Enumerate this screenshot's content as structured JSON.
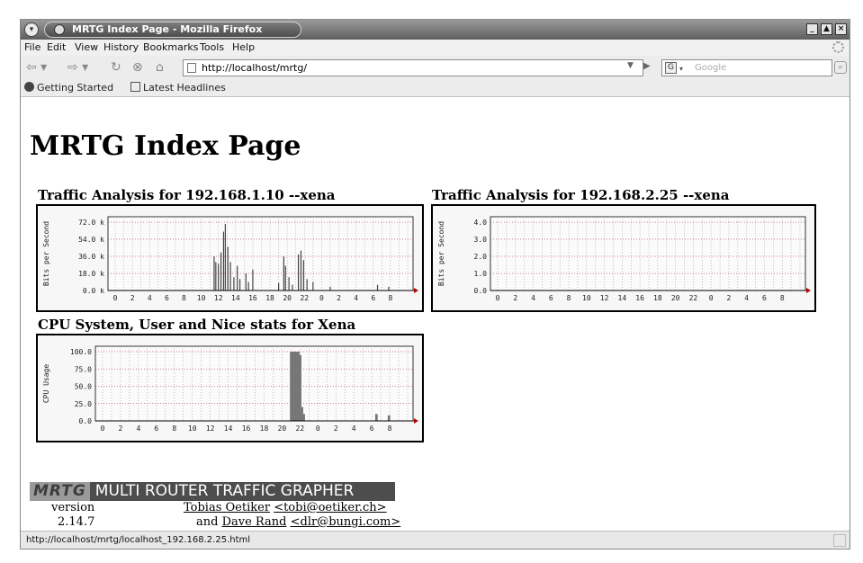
{
  "window": {
    "title": "MRTG Index Page - Mozilla Firefox",
    "controls": [
      "minimize-icon",
      "maximize-icon",
      "close-icon"
    ]
  },
  "menubar": {
    "items": [
      {
        "label": "File"
      },
      {
        "label": "Edit"
      },
      {
        "label": "View"
      },
      {
        "label": "History"
      },
      {
        "label": "Bookmarks"
      },
      {
        "label": "Tools"
      },
      {
        "label": "Help"
      }
    ]
  },
  "navbar": {
    "url": "http://localhost/mrtg/",
    "search_placeholder": "Google",
    "icons": [
      "back-icon",
      "forward-icon",
      "reload-icon",
      "stop-icon",
      "home-icon"
    ]
  },
  "bookmarks": {
    "items": [
      {
        "label": "Getting Started"
      },
      {
        "label": "Latest Headlines"
      }
    ]
  },
  "page": {
    "title": "MRTG Index Page",
    "graphs": [
      {
        "title": "Traffic Analysis for 192.168.1.10 --xena",
        "ylabel": "Bits per Second"
      },
      {
        "title": "Traffic Analysis for 192.168.2.25 --xena",
        "ylabel": "Bits per Second"
      },
      {
        "title": "CPU System, User and Nice stats for Xena",
        "ylabel": "CPU Usage"
      }
    ],
    "footer": {
      "logo_mark": "MRTG",
      "logo_text": "MULTI ROUTER TRAFFIC GRAPHER",
      "version_label": "version",
      "version_number": "2.14.7",
      "author1": "Tobias Oetiker",
      "author1_email": "<tobi@oetiker.ch>",
      "and_text": "and",
      "author2": "Dave Rand",
      "author2_email": "<dlr@bungi.com>"
    }
  },
  "status": {
    "text": "http://localhost/mrtg/localhost_192.168.2.25.html"
  },
  "chart_data": [
    {
      "type": "bar",
      "title": "Traffic Analysis for 192.168.1.10 --xena",
      "ylabel": "Bits per Second",
      "yticks": [
        "0.0 k",
        "18.0 k",
        "36.0 k",
        "54.0 k",
        "72.0 k"
      ],
      "xticks": [
        "0",
        "2",
        "4",
        "6",
        "8",
        "10",
        "12",
        "14",
        "16",
        "18",
        "20",
        "22",
        "0",
        "2",
        "4",
        "6",
        "8"
      ],
      "ylim": [
        0,
        72000
      ],
      "series": [
        {
          "values": [
            [
              11.5,
              36000
            ],
            [
              11.7,
              30000
            ],
            [
              12.0,
              28000
            ],
            [
              12.3,
              40000
            ],
            [
              12.6,
              62000
            ],
            [
              12.8,
              70000
            ],
            [
              13.1,
              46000
            ],
            [
              13.4,
              30000
            ],
            [
              13.8,
              14000
            ],
            [
              14.2,
              26000
            ],
            [
              14.5,
              12000
            ],
            [
              15.2,
              18000
            ],
            [
              15.5,
              9000
            ],
            [
              16.0,
              22000
            ],
            [
              19.0,
              8000
            ],
            [
              19.6,
              36000
            ],
            [
              19.8,
              26000
            ],
            [
              20.2,
              14000
            ],
            [
              20.6,
              6000
            ],
            [
              21.3,
              38000
            ],
            [
              21.6,
              42000
            ],
            [
              21.9,
              32000
            ],
            [
              22.3,
              12000
            ],
            [
              23.0,
              9000
            ],
            [
              1.0,
              4000
            ],
            [
              6.5,
              6000
            ],
            [
              7.8,
              4000
            ]
          ]
        }
      ]
    },
    {
      "type": "line",
      "title": "Traffic Analysis for 192.168.2.25 --xena",
      "ylabel": "Bits per Second",
      "yticks": [
        "0.0",
        "1.0",
        "2.0",
        "3.0",
        "4.0"
      ],
      "xticks": [
        "0",
        "2",
        "4",
        "6",
        "8",
        "10",
        "12",
        "14",
        "16",
        "18",
        "20",
        "22",
        "0",
        "2",
        "4",
        "6",
        "8"
      ],
      "ylim": [
        0,
        4
      ],
      "series": [
        {
          "values": []
        }
      ]
    },
    {
      "type": "bar",
      "title": "CPU System, User and Nice stats for Xena",
      "ylabel": "CPU Usage",
      "yticks": [
        "0.0",
        "25.0",
        "50.0",
        "75.0",
        "100.0"
      ],
      "xticks": [
        "0",
        "2",
        "4",
        "6",
        "8",
        "10",
        "12",
        "14",
        "16",
        "18",
        "20",
        "22",
        "0",
        "2",
        "4",
        "6",
        "8"
      ],
      "ylim": [
        0,
        100
      ],
      "series": [
        {
          "values": [
            [
              21.0,
              100
            ],
            [
              21.2,
              100
            ],
            [
              21.4,
              100
            ],
            [
              21.6,
              100
            ],
            [
              21.8,
              100
            ],
            [
              22.0,
              95
            ],
            [
              22.2,
              20
            ],
            [
              22.4,
              10
            ],
            [
              6.5,
              10
            ],
            [
              7.9,
              8
            ]
          ]
        }
      ]
    }
  ]
}
